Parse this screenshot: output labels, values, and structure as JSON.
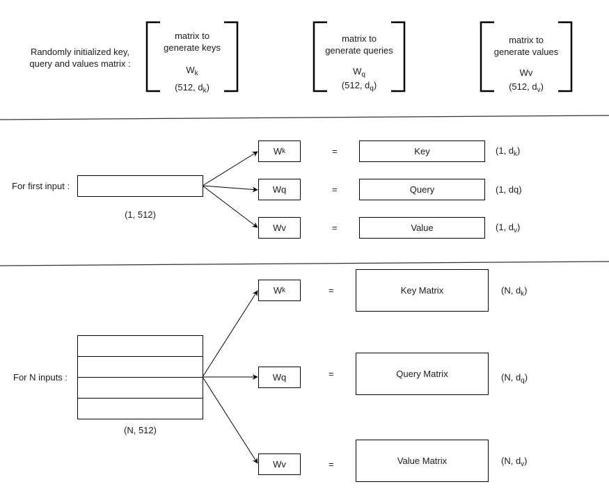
{
  "section_top": {
    "label_line1": "Randomly initialized key,",
    "label_line2": "query and values matrix :",
    "matrices": [
      {
        "line1": "matrix to",
        "line2": "generate keys",
        "symbol": "W",
        "symbol_sub": "k",
        "shape_prefix": "(512, d",
        "shape_sub": "k",
        "shape_suffix": ")"
      },
      {
        "line1": "matrix to",
        "line2": "generate queries",
        "symbol": "W",
        "symbol_sub": "q",
        "shape_prefix": "(512, d",
        "shape_sub": "q",
        "shape_suffix": ")"
      },
      {
        "line1": "matrix to",
        "line2": "generate values",
        "symbol": "Wv",
        "symbol_sub": "",
        "shape_prefix": "(512, d",
        "shape_sub": "v",
        "shape_suffix": ")"
      }
    ]
  },
  "section_first": {
    "label": "For first input :",
    "input_shape": "(1, 512)",
    "weights": [
      {
        "symbol": "W",
        "sub": "k"
      },
      {
        "symbol": "Wq",
        "sub": ""
      },
      {
        "symbol": "Wv",
        "sub": ""
      }
    ],
    "equals": "=",
    "outputs": [
      {
        "label": "Key",
        "shape_prefix": "(1, d",
        "shape_sub": "k",
        "shape_suffix": ")"
      },
      {
        "label": "Query",
        "shape_prefix": "(1, dq)",
        "shape_sub": "",
        "shape_suffix": ""
      },
      {
        "label": "Value",
        "shape_prefix": "(1, d",
        "shape_sub": "v",
        "shape_suffix": ")"
      }
    ]
  },
  "section_n": {
    "label": "For N inputs :",
    "input_shape": "(N, 512)",
    "weights": [
      {
        "symbol": "W",
        "sub": "k"
      },
      {
        "symbol": "Wq",
        "sub": ""
      },
      {
        "symbol": "Wv",
        "sub": ""
      }
    ],
    "equals": "=",
    "outputs": [
      {
        "label": "Key Matrix",
        "shape_prefix": "(N, d",
        "shape_sub": "k",
        "shape_suffix": ")"
      },
      {
        "label": "Query Matrix",
        "shape_prefix": "(N, d",
        "shape_sub": "q",
        "shape_suffix": ")"
      },
      {
        "label": "Value Matrix",
        "shape_prefix": "(N, d",
        "shape_sub": "v",
        "shape_suffix": ")"
      }
    ]
  }
}
